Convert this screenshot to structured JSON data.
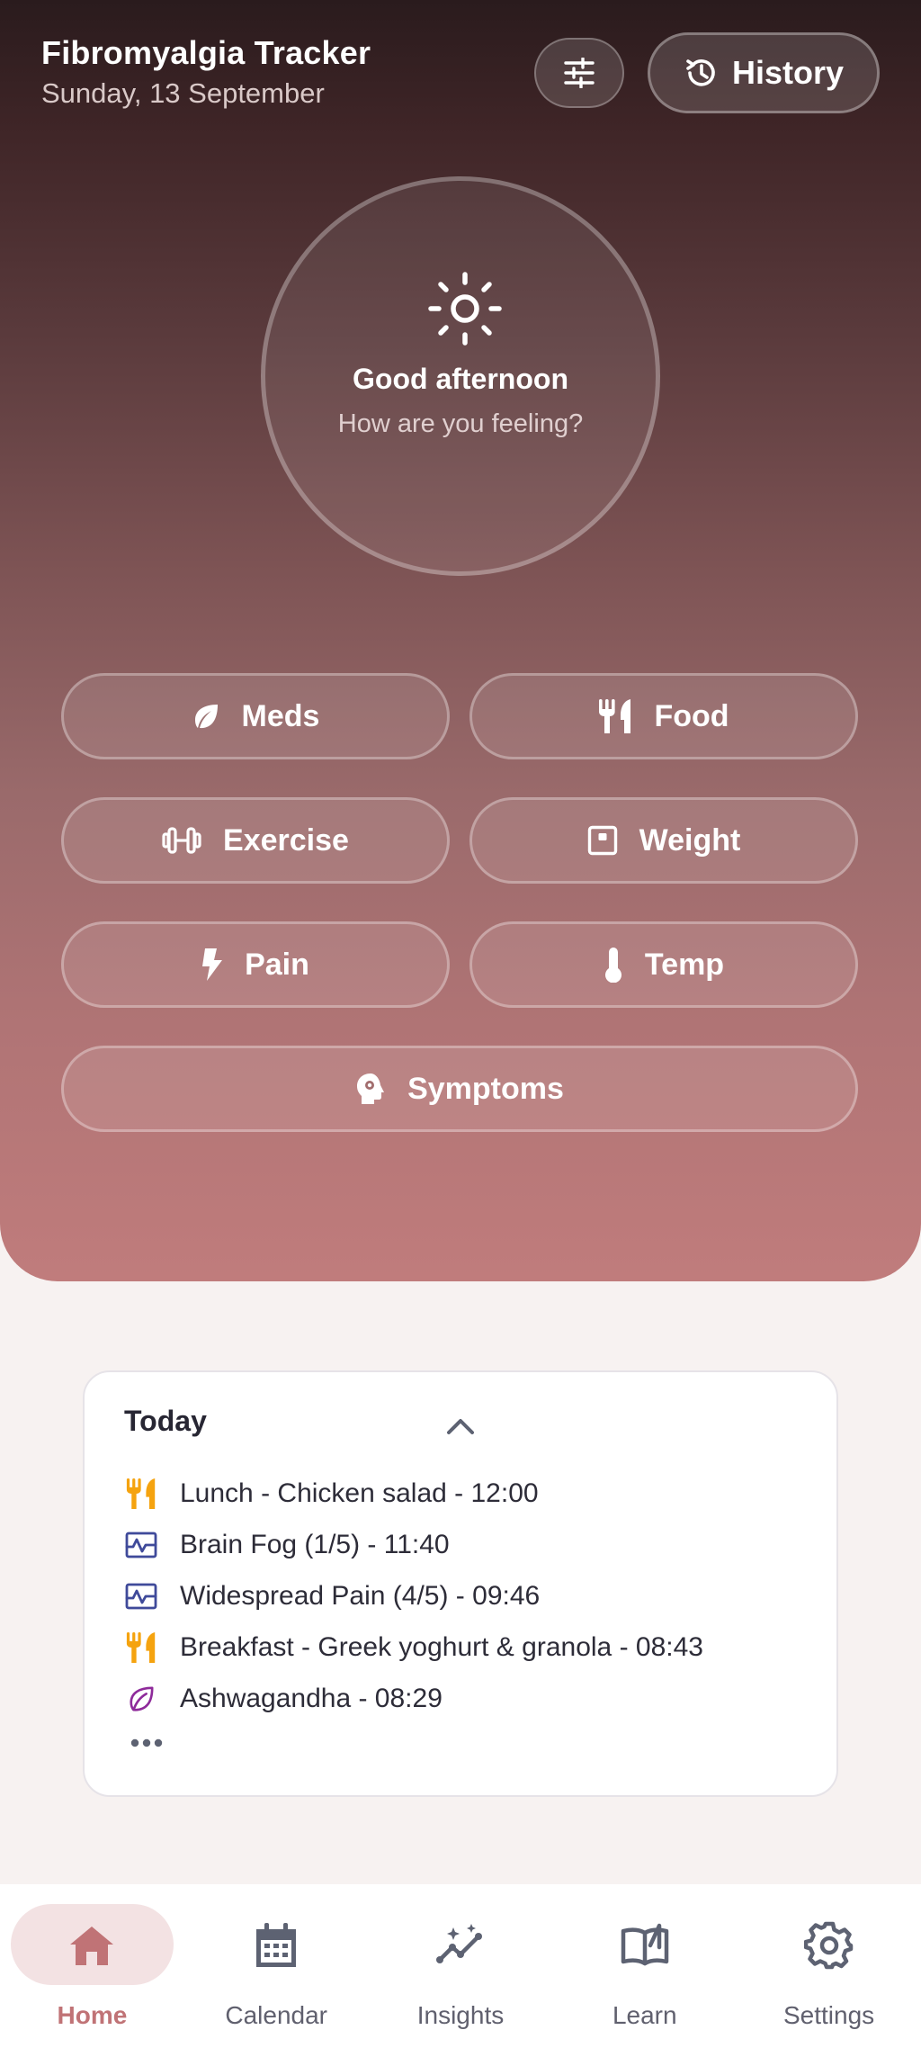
{
  "header": {
    "title": "Fibromyalgia Tracker",
    "date": "Sunday, 13 September",
    "history_label": "History"
  },
  "greeting": {
    "title": "Good afternoon",
    "subtitle": "How are you feeling?"
  },
  "actions": [
    {
      "label": "Meds",
      "icon": "leaf-icon"
    },
    {
      "label": "Food",
      "icon": "utensils-icon"
    },
    {
      "label": "Exercise",
      "icon": "dumbbell-icon"
    },
    {
      "label": "Weight",
      "icon": "scale-icon"
    },
    {
      "label": "Pain",
      "icon": "bolt-icon"
    },
    {
      "label": "Temp",
      "icon": "thermometer-icon"
    },
    {
      "label": "Symptoms",
      "icon": "head-gear-icon"
    }
  ],
  "today": {
    "title": "Today",
    "items": [
      {
        "text": "Lunch - Chicken salad - 12:00",
        "icon": "utensils-icon",
        "color": "#f5a30f"
      },
      {
        "text": "Brain Fog (1/5) - 11:40",
        "icon": "symptom-chart-icon",
        "color": "#3f4a9a"
      },
      {
        "text": "Widespread Pain (4/5) - 09:46",
        "icon": "symptom-chart-icon",
        "color": "#3f4a9a"
      },
      {
        "text": "Breakfast - Greek yoghurt & granola - 08:43",
        "icon": "utensils-icon",
        "color": "#f5a30f"
      },
      {
        "text": "Ashwagandha - 08:29",
        "icon": "leaf-icon",
        "color": "#8e2a9a"
      }
    ]
  },
  "nav": {
    "items": [
      {
        "label": "Home",
        "icon": "home-icon",
        "active": true
      },
      {
        "label": "Calendar",
        "icon": "calendar-icon",
        "active": false
      },
      {
        "label": "Insights",
        "icon": "insights-icon",
        "active": false
      },
      {
        "label": "Learn",
        "icon": "book-icon",
        "active": false
      },
      {
        "label": "Settings",
        "icon": "gear-icon",
        "active": false
      }
    ]
  },
  "colors": {
    "accent": "#c07376",
    "nav_inactive": "#5d6272",
    "food": "#f5a30f",
    "symptom": "#3f4a9a",
    "med": "#8e2a9a"
  }
}
